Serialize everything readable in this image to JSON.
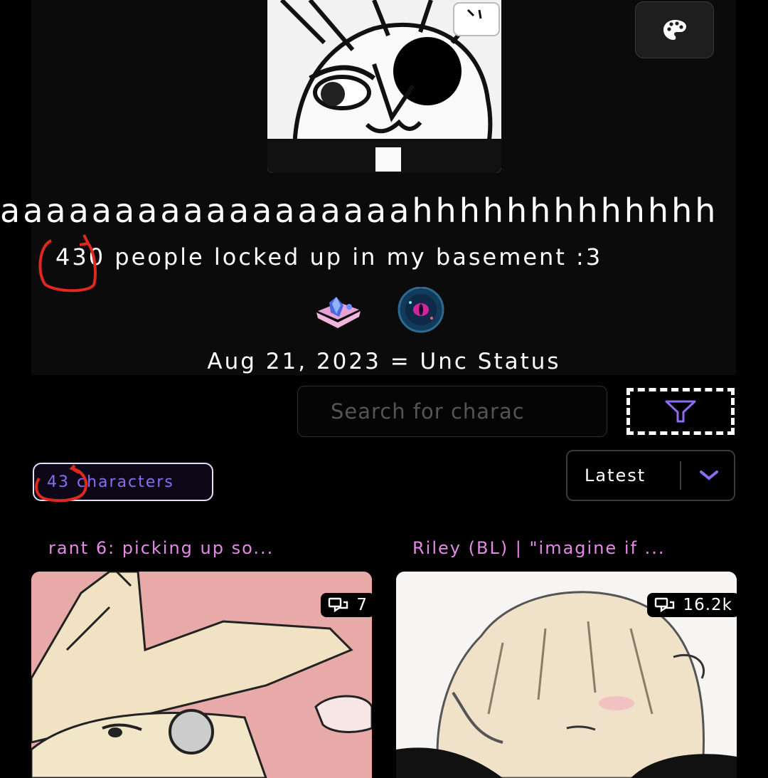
{
  "profile": {
    "username": "aaaaaaaaaaaaaaaaaahhhhhhhhhhhhh",
    "bio": "430 people locked up in my basement :3",
    "joined": "Aug 21, 2023 = Unc Status",
    "badges": [
      "book-crystal-badge",
      "eye-orb-badge"
    ]
  },
  "search": {
    "placeholder": "Search for charac"
  },
  "count": {
    "number": "43",
    "label": "characters"
  },
  "sort": {
    "selected": "Latest"
  },
  "cards": [
    {
      "title": "rant 6: picking up so...",
      "chats": "7"
    },
    {
      "title": "Riley (BL) | \"imagine if ...",
      "chats": "16.2k"
    }
  ],
  "colors": {
    "accent": "#8e6bf2",
    "card_title": "#e48ae6",
    "annotation": "#e0281e"
  }
}
